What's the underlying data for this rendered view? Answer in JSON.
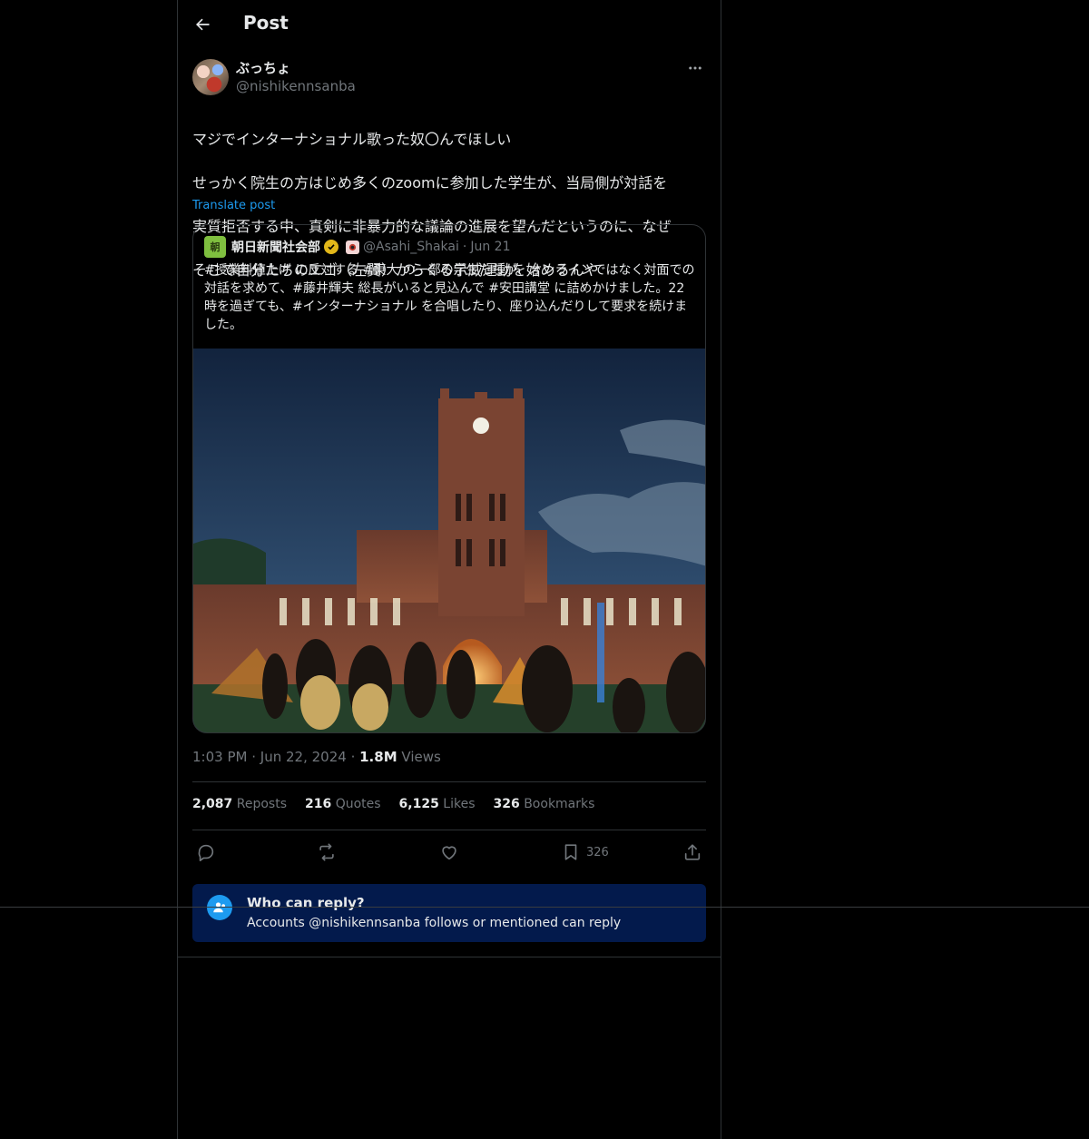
{
  "header": {
    "title": "Post"
  },
  "post": {
    "display_name": "ぶっちょ",
    "handle": "@nishikennsanba",
    "text_lines": [
      "マジでインターナショナル歌った奴〇んでほしい",
      "せっかく院生の方はじめ多くのzoomに参加した学生が、当局側が対話を",
      "実質拒否する中、真剣に非暴力的な議論の進展を望んだというのに、なぜ",
      "そこで自分たちのエゴ（左翼）からくる示威運動を始めるんや"
    ],
    "translate_label": "Translate post",
    "time": "1:03 PM",
    "date": "Jun 22, 2024",
    "views_count": "1.8M",
    "views_label": "Views"
  },
  "quote": {
    "avatar_glyph": "朝",
    "name": "朝日新聞社会部",
    "handle": "@Asahi_Shakai",
    "date": "Jun 21",
    "text": "#授業料値上げ に反対する #東大 の一部の学生たちが、オンラインではなく対面での対話を求めて、#藤井輝夫 総長がいると見込んで #安田講堂 に詰めかけました。22時を過ぎても、#インターナショナル を合唱したり、座り込んだりして要求を続けました。"
  },
  "stats": {
    "reposts_count": "2,087",
    "reposts_label": "Reposts",
    "quotes_count": "216",
    "quotes_label": "Quotes",
    "likes_count": "6,125",
    "likes_label": "Likes",
    "bookmarks_count": "326",
    "bookmarks_label": "Bookmarks"
  },
  "actions": {
    "bookmark_count": "326"
  },
  "reply_settings": {
    "title": "Who can reply?",
    "subtitle": "Accounts @nishikennsanba follows or mentioned can reply"
  },
  "colors": {
    "accent": "#1d9bf0",
    "reply_box_bg": "#031a4c",
    "verified_gold": "#e2b719"
  }
}
